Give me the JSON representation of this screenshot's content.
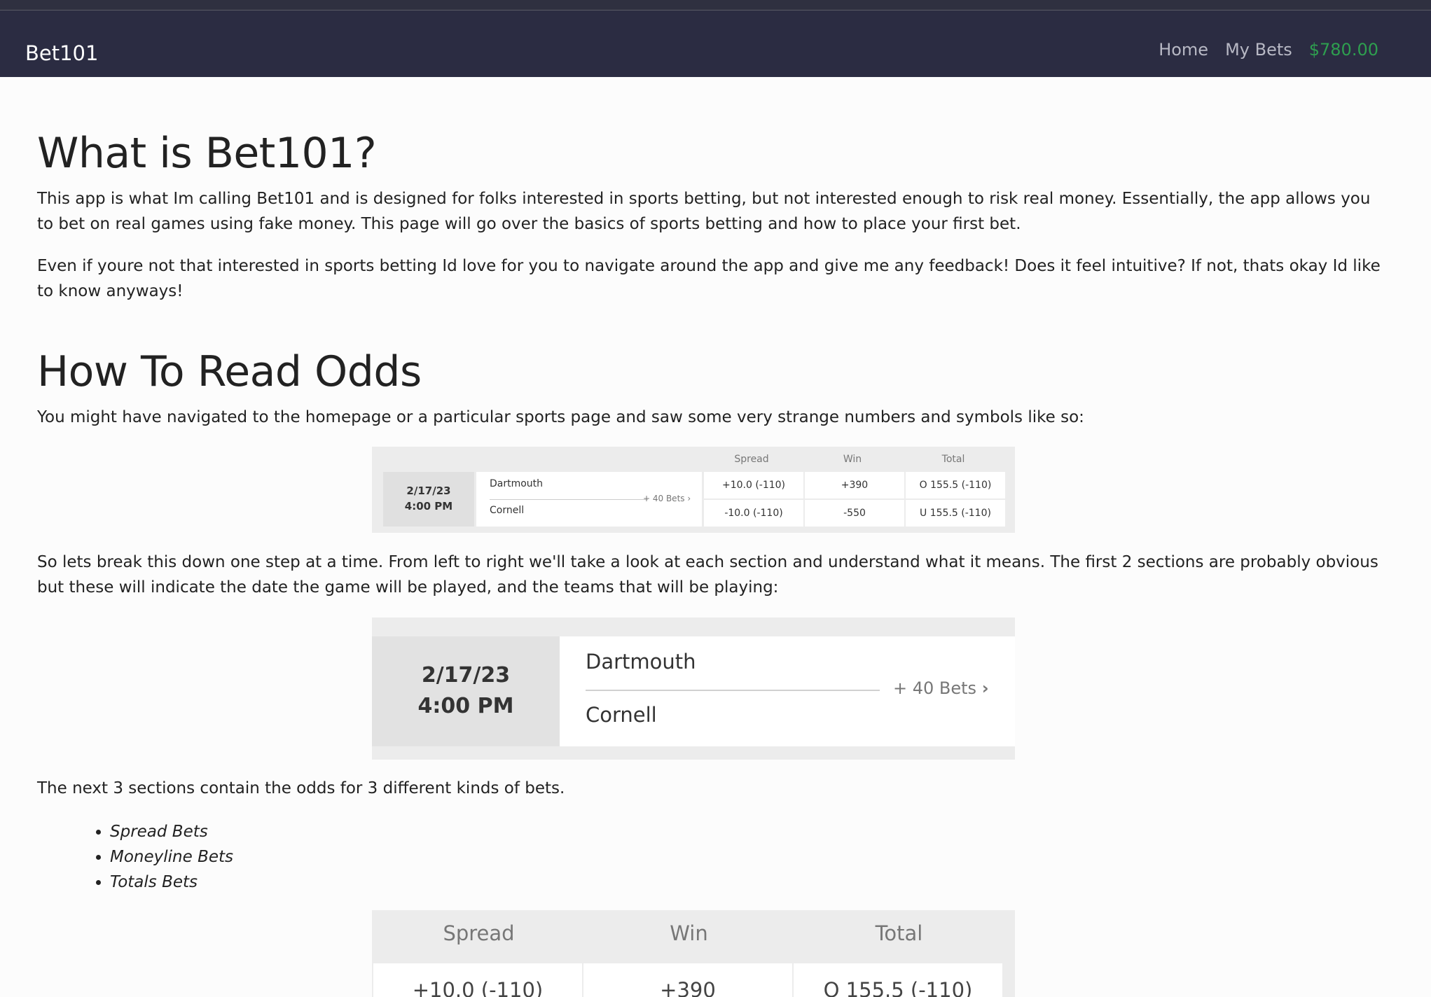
{
  "navbar": {
    "brand": "Bet101",
    "links": [
      {
        "label": "Home"
      },
      {
        "label": "My Bets"
      }
    ],
    "balance": "$780.00"
  },
  "section1": {
    "title": "What is Bet101?",
    "p1": "This app is what Im calling Bet101 and is designed for folks interested in sports betting, but not interested enough to risk real money. Essentially, the app allows you to bet on real games using fake money. This page will go over the basics of sports betting and how to place your first bet.",
    "p2": "Even if youre not that interested in sports betting Id love for you to navigate around the app and give me any feedback! Does it feel intuitive? If not, thats okay Id like to know anyways!"
  },
  "section2": {
    "title": "How To Read Odds",
    "p1": "You might have navigated to the homepage or a particular sports page and saw some very strange numbers and symbols like so:",
    "p2": "So lets break this down one step at a time. From left to right we'll take a look at each section and understand what it means. The first 2 sections are probably obvious but these will indicate the date the game will be played, and the teams that will be playing:",
    "p3": "The next 3 sections contain the odds for 3 different kinds of bets.",
    "bullets": [
      "Spread Bets",
      "Moneyline Bets",
      "Totals Bets"
    ]
  },
  "odds": {
    "headers": {
      "spread": "Spread",
      "win": "Win",
      "total": "Total"
    },
    "date": "2/17/23",
    "time": "4:00 PM",
    "team1": "Dartmouth",
    "team2": "Cornell",
    "more_bets": "+ 40 Bets",
    "row1": {
      "spread": "+10.0 (-110)",
      "win": "+390",
      "total": "O 155.5 (-110)"
    },
    "row2": {
      "spread": "-10.0 (-110)",
      "win": "-550",
      "total": "U 155.5 (-110)"
    }
  }
}
